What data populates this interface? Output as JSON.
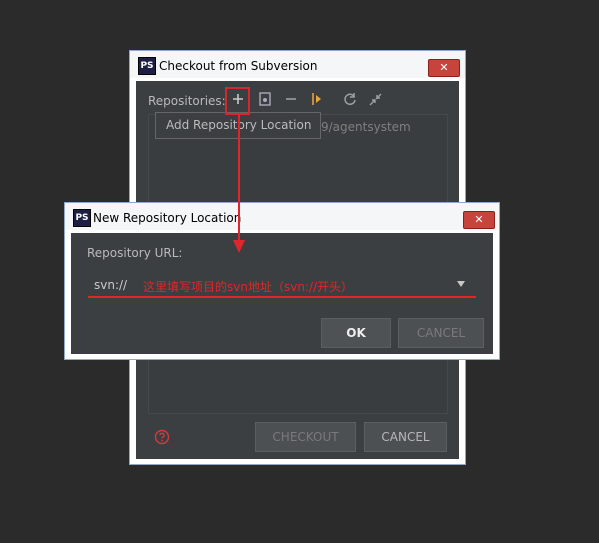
{
  "checkout_dialog": {
    "title": "Checkout from Subversion",
    "logo_text": "PS",
    "close_glyph": "✕",
    "repositories_label": "Repositories:",
    "repo_item_partial": "9/agentsystem",
    "tooltip": "Add Repository Location",
    "checkout_label": "CHECKOUT",
    "cancel_label": "CANCEL",
    "icons": [
      "add-icon",
      "browse-icon",
      "remove-icon",
      "checkout-arrow-icon",
      "refresh-icon",
      "collapse-icon",
      "help-icon"
    ]
  },
  "new_repo_dialog": {
    "title": "New Repository Location",
    "logo_text": "PS",
    "close_glyph": "✕",
    "url_label": "Repository URL:",
    "url_value": "svn://",
    "annotation": "这里填写项目的svn地址（svn://开头）",
    "ok_label": "OK",
    "cancel_label": "CANCEL"
  },
  "colors": {
    "dark_bg": "#3c3f41",
    "annotation_red": "#e0262a",
    "highlight_box": "#d9262a"
  }
}
